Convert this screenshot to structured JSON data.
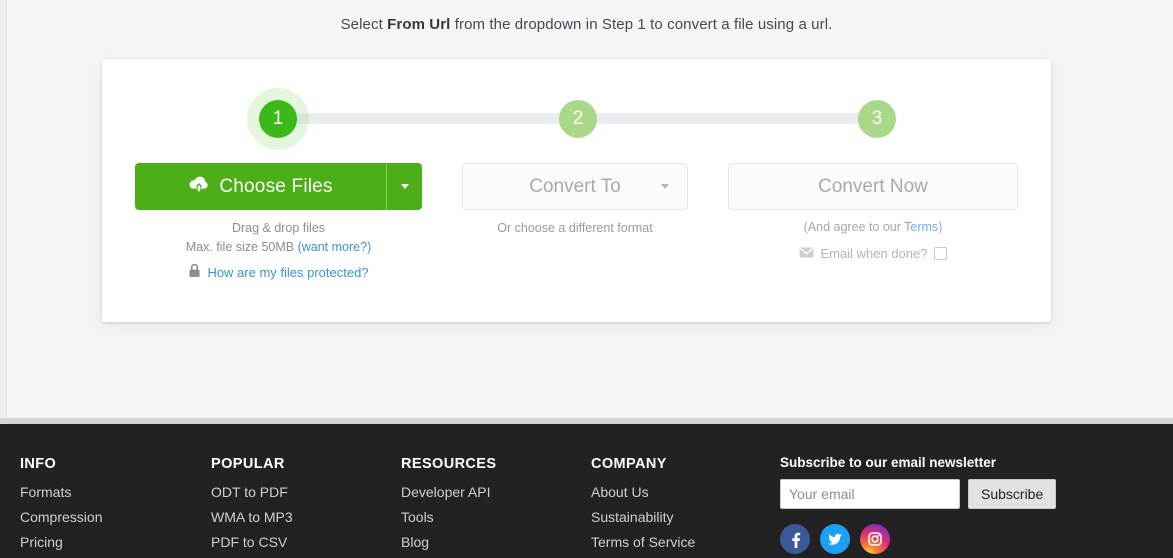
{
  "headline": {
    "before": "Select ",
    "bold": "From Url",
    "after": " from the dropdown in Step 1 to convert a file using a url."
  },
  "steps": [
    {
      "number": "1",
      "state": "active"
    },
    {
      "number": "2",
      "state": "inactive"
    },
    {
      "number": "3",
      "state": "inactive"
    }
  ],
  "step1": {
    "button_label": "Choose Files",
    "upload_icon": "cloud-upload-icon",
    "dropdown_icon": "chevron-down-icon",
    "drag_drop_text": "Drag & drop files",
    "max_size_text": "Max. file size 50MB ",
    "want_more_link": "(want more?)",
    "lock_icon": "lock-icon",
    "protected_link": "How are my files protected?"
  },
  "step2": {
    "button_label": "Convert To",
    "dropdown_icon": "chevron-down-icon",
    "helper_text": "Or choose a different format"
  },
  "step3": {
    "button_label": "Convert Now",
    "agree_prefix": "(And agree to our ",
    "terms_link": "Terms",
    "agree_suffix": ")",
    "email_icon": "envelope-icon",
    "email_label": "Email when done?",
    "checkbox_checked": false
  },
  "footer": {
    "columns": [
      {
        "title": "INFO",
        "links": [
          "Formats",
          "Compression",
          "Pricing"
        ]
      },
      {
        "title": "POPULAR",
        "links": [
          "ODT to PDF",
          "WMA to MP3",
          "PDF to CSV"
        ]
      },
      {
        "title": "RESOURCES",
        "links": [
          "Developer API",
          "Tools",
          "Blog"
        ]
      },
      {
        "title": "COMPANY",
        "links": [
          "About Us",
          "Sustainability",
          "Terms of Service"
        ]
      }
    ],
    "newsletter": {
      "title": "Subscribe to our email newsletter",
      "input_placeholder": "Your email",
      "input_value": "",
      "subscribe_label": "Subscribe"
    },
    "socials": [
      {
        "name": "facebook-icon",
        "color": "#3b5998"
      },
      {
        "name": "twitter-icon",
        "color": "#1da1f2"
      },
      {
        "name": "instagram-icon",
        "color": "#dd2a7b"
      }
    ]
  },
  "colors": {
    "accent_green": "#4caf18",
    "step_active": "#3bb919",
    "step_inactive": "#a9d889",
    "link_blue": "#3b92d6",
    "footer_bg": "#222222"
  }
}
